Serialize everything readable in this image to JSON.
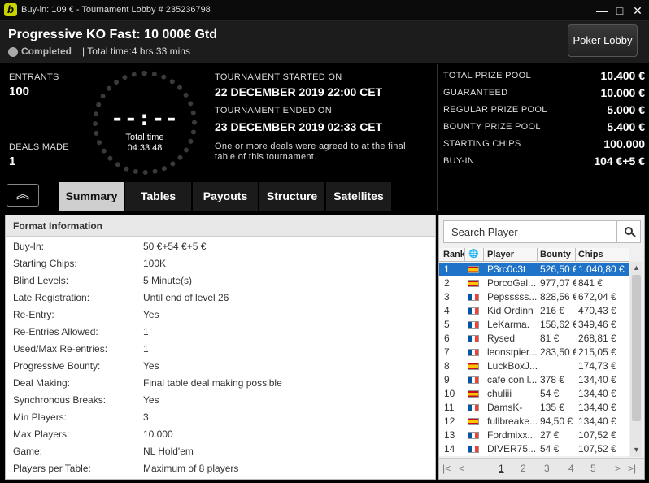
{
  "window": {
    "title": "Buy-in: 109 € - Tournament Lobby # 235236798",
    "logo": "b",
    "minimize_glyph": "—",
    "restore_glyph": "□",
    "close_glyph": "✕"
  },
  "header": {
    "tournament_name": "Progressive KO Fast: 10 000€ Gtd",
    "status": "Completed",
    "total_time": "| Total time:4 hrs  33 mins",
    "poker_lobby_button": "Poker Lobby"
  },
  "info": {
    "entrants_label": "ENTRANTS",
    "entrants_value": "100",
    "deals_label": "DEALS MADE",
    "deals_value": "1",
    "clock_digits": "--:--",
    "clock_label": "Total time",
    "clock_value": "04:33:48",
    "started_label": "TOURNAMENT STARTED ON",
    "started_value": "22 DECEMBER 2019  22:00 CET",
    "ended_label": "TOURNAMENT ENDED ON",
    "ended_value": "23 DECEMBER 2019  02:33 CET",
    "deal_note": "One or more deals were agreed to at the final table of this tournament."
  },
  "tabs": [
    {
      "label": "Summary",
      "active": true
    },
    {
      "label": "Tables",
      "active": false
    },
    {
      "label": "Payouts",
      "active": false
    },
    {
      "label": "Structure",
      "active": false
    },
    {
      "label": "Satellites",
      "active": false
    }
  ],
  "collapse_glyph": "︽",
  "prizes": [
    {
      "label": "TOTAL PRIZE POOL",
      "value": "10.400 €"
    },
    {
      "label": "GUARANTEED",
      "value": "10.000 €"
    },
    {
      "label": "REGULAR PRIZE POOL",
      "value": "5.000 €"
    },
    {
      "label": "BOUNTY PRIZE POOL",
      "value": "5.400 €"
    },
    {
      "label": "STARTING CHIPS",
      "value": "100.000"
    },
    {
      "label": "BUY-IN",
      "value": "104 €+5 €"
    }
  ],
  "format": {
    "heading": "Format Information",
    "rows": [
      {
        "k": "Buy-In:",
        "v": "50 €+54 €+5 €"
      },
      {
        "k": "Starting Chips:",
        "v": "100K"
      },
      {
        "k": "Blind Levels:",
        "v": "5 Minute(s)"
      },
      {
        "k": "Late Registration:",
        "v": "Until end of level 26"
      },
      {
        "k": "Re-Entry:",
        "v": "Yes"
      },
      {
        "k": "Re-Entries Allowed:",
        "v": "1"
      },
      {
        "k": "Used/Max Re-entries:",
        "v": "1"
      },
      {
        "k": "Progressive Bounty:",
        "v": "Yes"
      },
      {
        "k": "Deal Making:",
        "v": "Final table deal making possible"
      },
      {
        "k": "Synchronous Breaks:",
        "v": "Yes"
      },
      {
        "k": "Min Players:",
        "v": "3"
      },
      {
        "k": "Max Players:",
        "v": "10.000"
      },
      {
        "k": "Game:",
        "v": "NL Hold'em"
      },
      {
        "k": "Players per Table:",
        "v": "Maximum of 8 players"
      }
    ]
  },
  "players": {
    "search_placeholder": "Search Player",
    "columns": {
      "rank": "Rank",
      "player": "Player",
      "bounty": "Bounty",
      "chips": "Chips"
    },
    "globe_glyph": "🌐",
    "rows": [
      {
        "rank": "1",
        "flag": "es",
        "player": "P3rc0c3t",
        "bounty": "526,50 €",
        "chips": "1.040,80 €"
      },
      {
        "rank": "2",
        "flag": "es",
        "player": "PorcoGal...",
        "bounty": "977,07 €",
        "chips": "841 €"
      },
      {
        "rank": "3",
        "flag": "fr",
        "player": "Pepsssss...",
        "bounty": "828,56 €",
        "chips": "672,04 €"
      },
      {
        "rank": "4",
        "flag": "fr",
        "player": "Kid Ordinn",
        "bounty": "216 €",
        "chips": "470,43 €"
      },
      {
        "rank": "5",
        "flag": "fr",
        "player": "LeKarma.",
        "bounty": "158,62 €",
        "chips": "349,46 €"
      },
      {
        "rank": "6",
        "flag": "fr",
        "player": "Rysed",
        "bounty": "81 €",
        "chips": "268,81 €"
      },
      {
        "rank": "7",
        "flag": "fr",
        "player": "leonstpier...",
        "bounty": "283,50 €",
        "chips": "215,05 €"
      },
      {
        "rank": "8",
        "flag": "es",
        "player": "LuckBoxJ...",
        "bounty": "",
        "chips": "174,73 €"
      },
      {
        "rank": "9",
        "flag": "fr",
        "player": "cafe con l...",
        "bounty": "378 €",
        "chips": "134,40 €"
      },
      {
        "rank": "10",
        "flag": "es",
        "player": "chuliii",
        "bounty": "54 €",
        "chips": "134,40 €"
      },
      {
        "rank": "11",
        "flag": "fr",
        "player": "DamsK-",
        "bounty": "135 €",
        "chips": "134,40 €"
      },
      {
        "rank": "12",
        "flag": "es",
        "player": "fullbreake...",
        "bounty": "94,50 €",
        "chips": "134,40 €"
      },
      {
        "rank": "13",
        "flag": "fr",
        "player": "Fordmixx...",
        "bounty": "27 €",
        "chips": "107,52 €"
      },
      {
        "rank": "14",
        "flag": "fr",
        "player": "DIVER75...",
        "bounty": "54 €",
        "chips": "107,52 €"
      }
    ],
    "pager": {
      "first": "|<",
      "prev": "<",
      "pages": [
        "1",
        "2",
        "3",
        "4",
        "5"
      ],
      "next": ">",
      "last": ">|"
    }
  }
}
